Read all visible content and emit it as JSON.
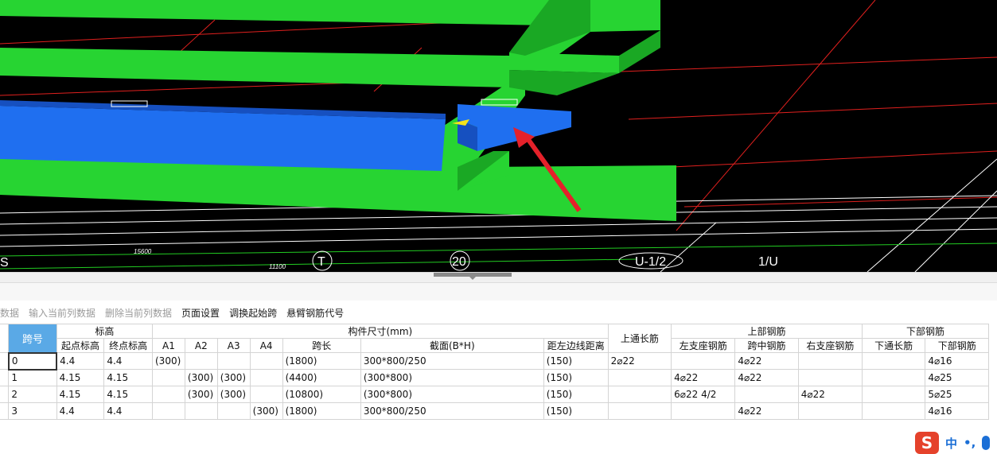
{
  "viewport": {
    "axis_labels": [
      "S",
      "T",
      "20",
      "U-1/2",
      "1/U"
    ],
    "dimension_labels": [
      "15600",
      "11100"
    ],
    "colors": {
      "background": "#000000",
      "slab": "#27d432",
      "beam": "#1f6ff0",
      "grid_line": "#e0201e",
      "axis_line": "#ffffff",
      "arrow": "#e5212a",
      "dim_line": "#22cc22"
    }
  },
  "toolbar": {
    "items": [
      {
        "label": "数据",
        "enabled": false
      },
      {
        "label": "输入当前列数据",
        "enabled": false
      },
      {
        "label": "删除当前列数据",
        "enabled": false
      },
      {
        "label": "页面设置",
        "enabled": true
      },
      {
        "label": "调换起始跨",
        "enabled": true
      },
      {
        "label": "悬臂钢筋代号",
        "enabled": true
      }
    ]
  },
  "table": {
    "headers": {
      "span_no": "跨号",
      "elevation": "标高",
      "start_elev": "起点标高",
      "end_elev": "终点标高",
      "dims": "构件尺寸(mm)",
      "a1": "A1",
      "a2": "A2",
      "a3": "A3",
      "a4": "A4",
      "span_len": "跨长",
      "section": "截面(B*H)",
      "offset": "距左边线距离",
      "top_through": "上通长筋",
      "top_rebar": "上部钢筋",
      "left_support": "左支座钢筋",
      "mid": "跨中钢筋",
      "right_support": "右支座钢筋",
      "bottom_rebar": "下部钢筋",
      "bottom_through": "下通长筋",
      "bottom": "下部钢筋"
    },
    "rows": [
      {
        "rowhead": "",
        "span": "0",
        "start": "4.4",
        "end": "4.4",
        "a1": "(300)",
        "a2": "",
        "a3": "",
        "a4": "",
        "len": "(1800)",
        "section": "300*800/250",
        "offset": "(150)",
        "top_through": "2⌀22",
        "left": "",
        "mid": "4⌀22",
        "right": "",
        "bot_through": "",
        "bottom": "4⌀16"
      },
      {
        "rowhead": "3",
        "span": "1",
        "start": "4.15",
        "end": "4.15",
        "a1": "",
        "a2": "(300)",
        "a3": "(300)",
        "a4": "",
        "len": "(4400)",
        "section": "(300*800)",
        "offset": "(150)",
        "top_through": "",
        "left": "4⌀22",
        "mid": "4⌀22",
        "right": "",
        "bot_through": "",
        "bottom": "4⌀25"
      },
      {
        "rowhead": "",
        "span": "2",
        "start": "4.15",
        "end": "4.15",
        "a1": "",
        "a2": "(300)",
        "a3": "(300)",
        "a4": "",
        "len": "(10800)",
        "section": "(300*800)",
        "offset": "(150)",
        "top_through": "",
        "left": "6⌀22 4/2",
        "mid": "",
        "right": "4⌀22",
        "bot_through": "",
        "bottom": "5⌀25"
      },
      {
        "rowhead": "",
        "span": "3",
        "start": "4.4",
        "end": "4.4",
        "a1": "",
        "a2": "",
        "a3": "",
        "a4": "(300)",
        "len": "(1800)",
        "section": "300*800/250",
        "offset": "(150)",
        "top_through": "",
        "left": "",
        "mid": "4⌀22",
        "right": "",
        "bot_through": "",
        "bottom": "4⌀16"
      }
    ]
  },
  "ime": {
    "logo": "S",
    "lang": "中",
    "punct": "•,"
  }
}
